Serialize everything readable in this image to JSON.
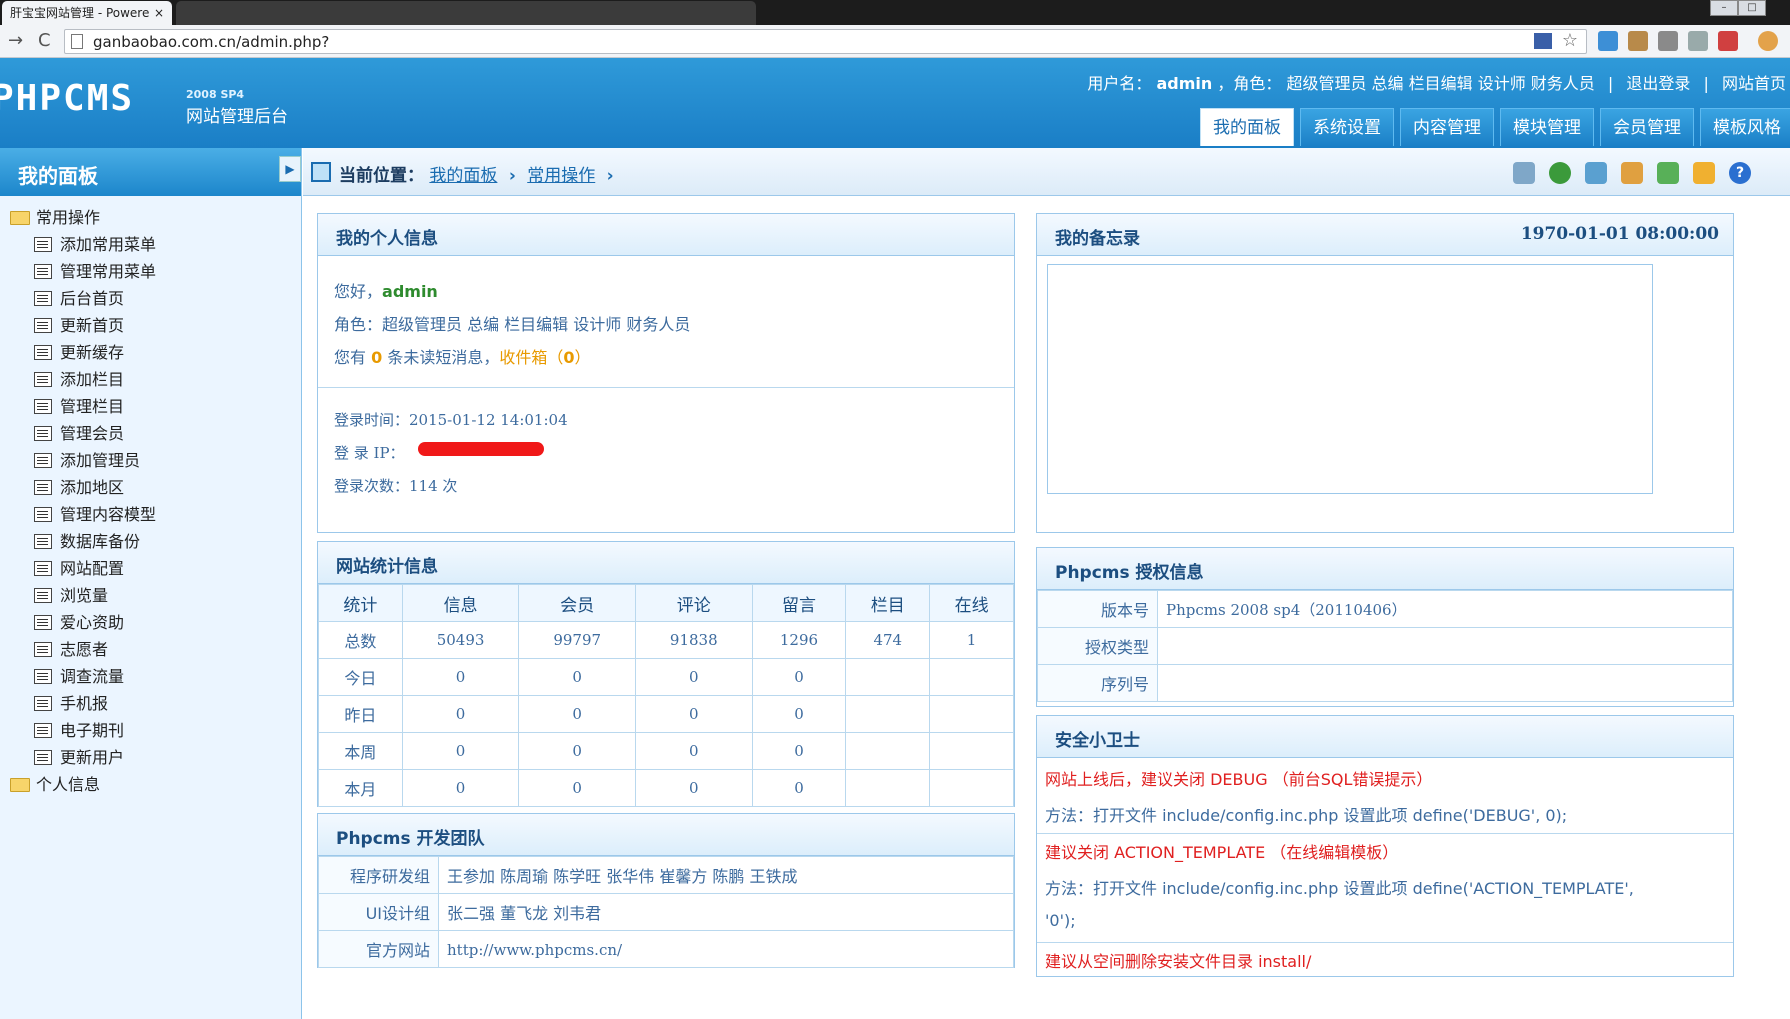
{
  "browser": {
    "tab_title": "肝宝宝网站管理 - Powere",
    "tab_close": "×",
    "url": "ganbaobao.com.cn/admin.php?",
    "back": "→",
    "reload": "C"
  },
  "header": {
    "logo_text": "PHPCMS",
    "logo_version": "2008 SP4",
    "logo_subtitle": "网站管理后台",
    "user_label": "用户名：",
    "user_name": "admin",
    "role_label": "，角色：",
    "roles": "超级管理员 总编 栏目编辑 设计师 财务人员",
    "logout": "退出登录",
    "site_home": "网站首页",
    "divider": "|",
    "nav": [
      "我的面板",
      "系统设置",
      "内容管理",
      "模块管理",
      "会员管理",
      "模板风格"
    ]
  },
  "sidebar": {
    "title": "我的面板",
    "pin": "▶",
    "group1": "常用操作",
    "items": [
      "添加常用菜单",
      "管理常用菜单",
      "后台首页",
      "更新首页",
      "更新缓存",
      "添加栏目",
      "管理栏目",
      "管理会员",
      "添加管理员",
      "添加地区",
      "管理内容模型",
      "数据库备份",
      "网站配置",
      "浏览量",
      "爱心资助",
      "志愿者",
      "调查流量",
      "手机报",
      "电子期刊",
      "更新用户"
    ],
    "group2": "个人信息"
  },
  "breadcrumb": {
    "label": "当前位置：",
    "path": [
      "我的面板",
      "常用操作"
    ],
    "sep": "›"
  },
  "personal": {
    "title": "我的个人信息",
    "hello": "您好，",
    "user": "admin",
    "roles_line": "角色：超级管理员 总编 栏目编辑 设计师 财务人员",
    "msg_prefix": "您有",
    "msg_count": "0",
    "msg_mid": "条未读短消息，",
    "inbox": "收件箱（",
    "inbox_count": "0",
    "inbox_close": "）",
    "login_time": "登录时间：2015-01-12 14:01:04",
    "login_ip_label": "登 录 IP：",
    "login_count": "登录次数：114 次"
  },
  "memo": {
    "title": "我的备忘录",
    "datetime": "1970-01-01 08:00:00"
  },
  "stats": {
    "title": "网站统计信息",
    "headers": [
      "统计",
      "信息",
      "会员",
      "评论",
      "留言",
      "栏目",
      "在线"
    ],
    "rows": [
      [
        "总数",
        "50493",
        "99797",
        "91838",
        "1296",
        "474",
        "1"
      ],
      [
        "今日",
        "0",
        "0",
        "0",
        "0",
        "",
        ""
      ],
      [
        "昨日",
        "0",
        "0",
        "0",
        "0",
        "",
        ""
      ],
      [
        "本周",
        "0",
        "0",
        "0",
        "0",
        "",
        ""
      ],
      [
        "本月",
        "0",
        "0",
        "0",
        "0",
        "",
        ""
      ]
    ]
  },
  "license": {
    "title": "Phpcms 授权信息",
    "rows": [
      [
        "版本号",
        "Phpcms 2008 sp4（20110406）"
      ],
      [
        "授权类型",
        ""
      ],
      [
        "序列号",
        ""
      ]
    ]
  },
  "team": {
    "title": "Phpcms 开发团队",
    "rows": [
      [
        "程序研发组",
        "王参加 陈周瑜 陈学旺 张华伟 崔馨方 陈鹏 王铁成"
      ],
      [
        "UI设计组",
        "张二强 董飞龙 刘韦君"
      ],
      [
        "官方网站",
        "http://www.phpcms.cn/"
      ]
    ]
  },
  "security": {
    "title": "安全小卫士",
    "tip1": "网站上线后，建议关闭 DEBUG （前台SQL错误提示）",
    "fix1": "方法：打开文件 include/config.inc.php 设置此项 define('DEBUG', 0);",
    "tip2": "建议关闭 ACTION_TEMPLATE （在线编辑模板）",
    "fix2a": "方法：打开文件 include/config.inc.php 设置此项 define('ACTION_TEMPLATE',",
    "fix2b": "'0');",
    "tip3": "建议从空间删除安装文件目录 install/"
  },
  "colors": {
    "header_blue": "#1a7ec6",
    "link_blue": "#1a6cb0",
    "warning_red": "#e02020",
    "accent_orange": "#e89a00"
  }
}
